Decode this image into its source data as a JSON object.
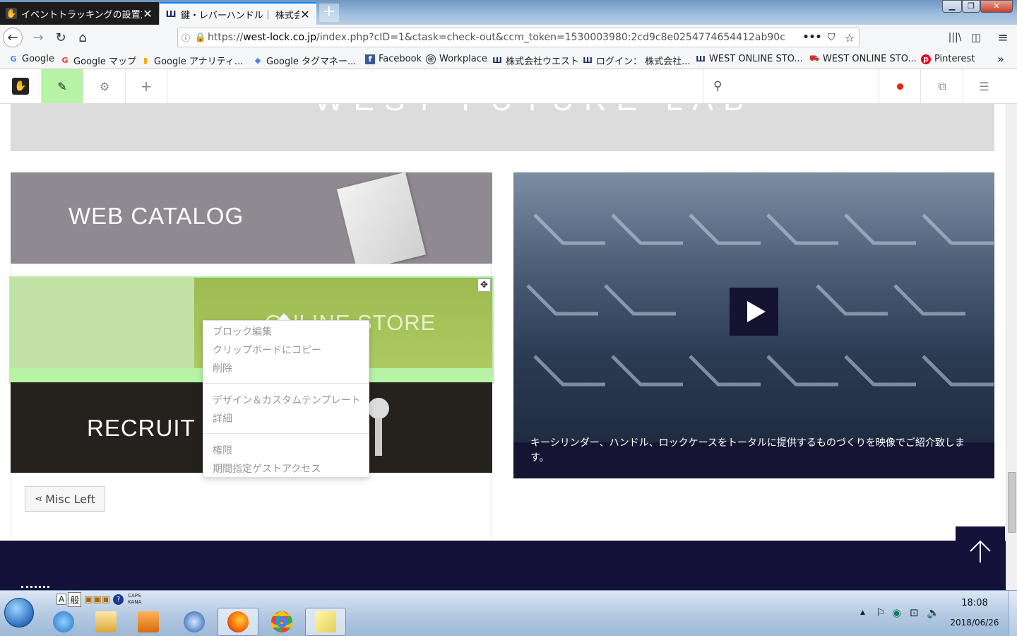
{
  "browser": {
    "tabs": [
      {
        "title": "イベントトラッキングの設置方",
        "active": false
      },
      {
        "title": "鍵・レバーハンドル｜ 株式会社",
        "active": true
      }
    ],
    "url_prefix": "https://",
    "url_domain": "west-lock.co.jp",
    "url_rest": "/index.php?cID=1&ctask=check-out&ccm_token=1530003980:2cd9c8e0254774654412ab90c",
    "bookmarks": [
      "Google",
      "Google マップ",
      "Google アナリティ...",
      "Google タグマネー...",
      "Facebook",
      "Workplace",
      "株式会社ウエスト",
      "ログイン： 株式会社...",
      "WEST ONLINE STO...",
      "WEST ONLINE STO...",
      "Pinterest"
    ]
  },
  "page": {
    "banner_text": "WEST FUTURE LAB",
    "catalog_title": "WEB CATALOG",
    "store_title": "ONLINE STORE",
    "recruit_title": "RECRUIT",
    "misc_button": "Misc Left",
    "video_caption": "キーシリンダー、ハンドル、ロックケースをトータルに提供するものづくりを映像でご紹介致します。"
  },
  "context_menu": {
    "group1": [
      "ブロック編集",
      "クリップボードにコピー",
      "削除"
    ],
    "group2": [
      "デザイン＆カスタムテンプレート",
      "詳細"
    ],
    "group3": [
      "権限",
      "期間指定ゲストアクセス"
    ]
  },
  "taskbar": {
    "time": "18:08",
    "date": "2018/06/26",
    "ime_mode": "般",
    "caps": "CAPS",
    "kana": "KANA"
  },
  "colors": {
    "edit_active": "#b6f3a5",
    "navy": "#14123a",
    "caption_bg": "#161433"
  }
}
